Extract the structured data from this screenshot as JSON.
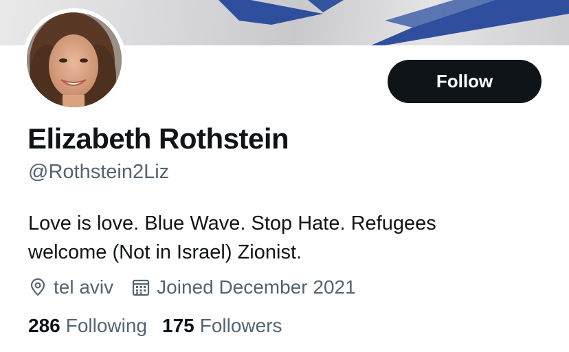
{
  "profile": {
    "name": "Elizabeth Rothstein",
    "handle": "@Rothstein2Liz",
    "bio_line1": "Love is love. Blue Wave. Stop Hate. Refugees",
    "bio_line2": "welcome (Not in Israel) Zionist.",
    "location": "tel aviv",
    "joined": "Joined December 2021"
  },
  "actions": {
    "follow_label": "Follow"
  },
  "stats": {
    "following_count": "286",
    "following_label": "Following",
    "followers_count": "175",
    "followers_label": "Followers"
  },
  "icons": {
    "location": "location-pin-icon",
    "calendar": "calendar-icon"
  },
  "colors": {
    "text": "#0f1419",
    "secondary": "#536471",
    "button": "#0f1419",
    "banner_blue": "#2f4f9e"
  }
}
